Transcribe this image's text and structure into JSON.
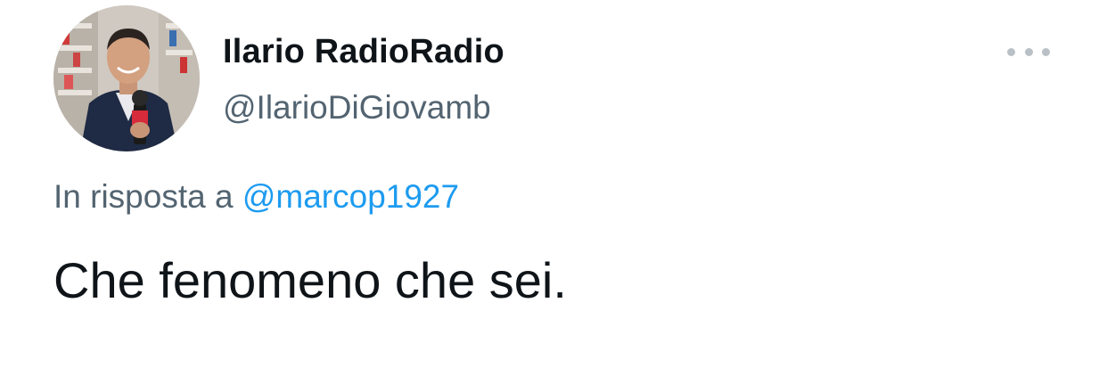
{
  "tweet": {
    "author": {
      "display_name": "Ilario RadioRadio",
      "handle": "@IlarioDiGiovamb"
    },
    "reply": {
      "prefix": "In risposta a",
      "mention": "@marcop1927"
    },
    "text": "Che fenomeno che sei."
  },
  "icons": {
    "more": "more-horizontal-icon"
  },
  "colors": {
    "text_primary": "#0f1419",
    "text_secondary": "#536471",
    "link": "#1d9bf0",
    "more_dots": "#b9c0c6",
    "background": "#ffffff"
  }
}
